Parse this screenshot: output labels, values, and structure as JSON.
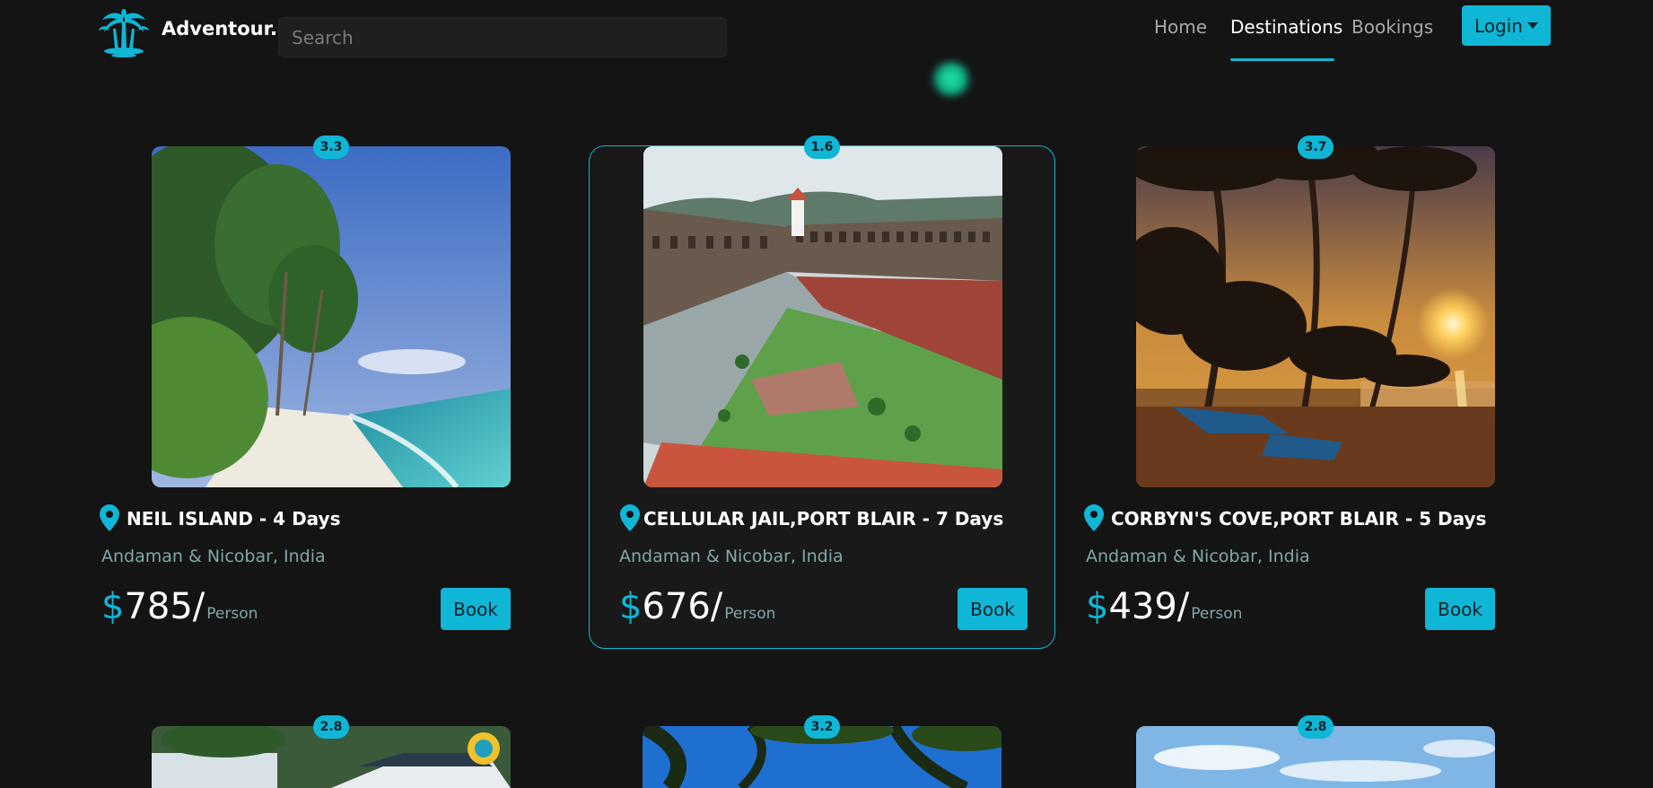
{
  "brand": {
    "name": "Adventour.",
    "logo_icon": "palm-tree-icon"
  },
  "search": {
    "placeholder": "Search"
  },
  "nav": {
    "home": "Home",
    "destinations": "Destinations",
    "bookings": "Bookings",
    "active": "Destinations",
    "login": "Login"
  },
  "colors": {
    "accent": "#0fb6d6",
    "background": "#141414",
    "muted_text": "#7fa8a8"
  },
  "cards": [
    {
      "rating": "3.3",
      "title": "NEIL ISLAND - 4 Days",
      "location": "Andaman & Nicobar, India",
      "currency": "$",
      "price": "785/",
      "per": "Person",
      "book": "Book"
    },
    {
      "rating": "1.6",
      "title": "CELLULAR JAIL,PORT BLAIR - 7 Days",
      "location": "Andaman & Nicobar, India",
      "currency": "$",
      "price": "676/",
      "per": "Person",
      "book": "Book"
    },
    {
      "rating": "3.7",
      "title": "CORBYN'S COVE,PORT BLAIR - 5 Days",
      "location": "Andaman & Nicobar, India",
      "currency": "$",
      "price": "439/",
      "per": "Person",
      "book": "Book"
    },
    {
      "rating": "2.8"
    },
    {
      "rating": "3.2"
    },
    {
      "rating": "2.8"
    }
  ]
}
